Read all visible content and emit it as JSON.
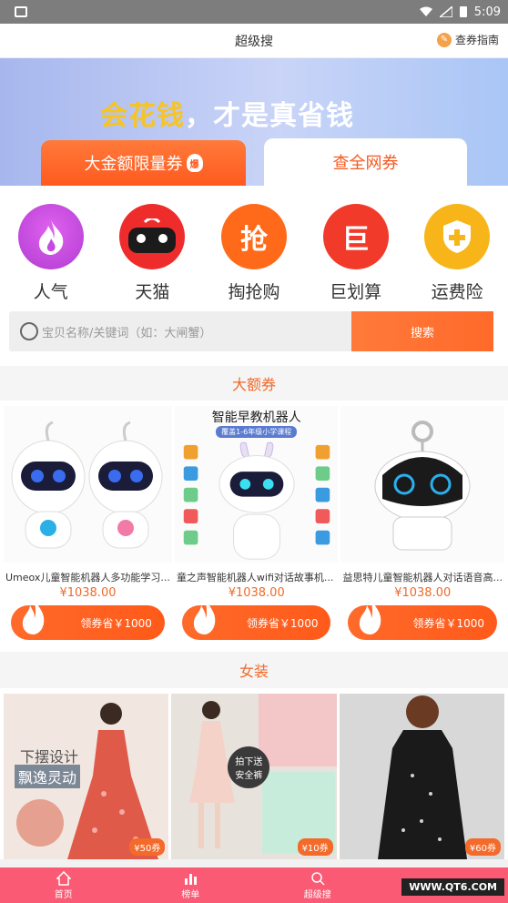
{
  "status_bar": {
    "time": "5:09"
  },
  "header": {
    "title": "超级搜",
    "guide_label": "查券指南"
  },
  "banner": {
    "slogan_part1": "会花钱",
    "slogan_part2": "，才是真省钱",
    "tab_big_coupon": "大金额限量券",
    "tab_big_coupon_badge": "爆",
    "tab_all_coupon": "查全网券"
  },
  "categories": [
    {
      "label": "人气",
      "icon": "fire-icon",
      "color": "#c64ae0"
    },
    {
      "label": "天猫",
      "icon": "tmall-bag-icon",
      "color": "#ee2c2c"
    },
    {
      "label": "掏抢购",
      "icon": "grab-icon",
      "glyph": "抢",
      "color": "#ff6a1a"
    },
    {
      "label": "巨划算",
      "icon": "ju-icon",
      "glyph": "巨",
      "color": "#f23a2a"
    },
    {
      "label": "运费险",
      "icon": "shield-plus-icon",
      "glyph": "+",
      "color": "#f7b51a"
    }
  ],
  "search": {
    "placeholder": "宝贝名称/关键词（如：大闸蟹）",
    "button_label": "搜索"
  },
  "sections": {
    "big_coupon_title": "大额券",
    "womens_title": "女装"
  },
  "big_coupon_products": [
    {
      "name": "Umeox儿童智能机器人多功能学习...",
      "price": "¥1038.00",
      "coupon": "领券省￥1000"
    },
    {
      "name": "童之声智能机器人wifi对话故事机...",
      "price": "¥1038.00",
      "coupon": "领券省￥1000",
      "image_title": "智能早教机器人",
      "image_subtitle": "覆盖1-6年级小学课程"
    },
    {
      "name": "益思特儿童智能机器人对话语音高...",
      "price": "¥1038.00",
      "coupon": "领券省￥1000"
    }
  ],
  "fashion_products": [
    {
      "tag": "¥50券",
      "overlay_1": "下摆设计",
      "overlay_2": "飘逸灵动",
      "colors": [
        "#f1e6e0",
        "#e05a4a"
      ]
    },
    {
      "tag": "¥10券",
      "overlay_1": "拍下送",
      "overlay_2": "安全裤",
      "colors": [
        "#e8e2dc",
        "#f3c6c8"
      ]
    },
    {
      "tag": "¥60券",
      "colors": [
        "#d8d8d8",
        "#1a1a1a"
      ]
    }
  ],
  "tab_bar": [
    {
      "label": "首页",
      "icon": "home-icon"
    },
    {
      "label": "榜单",
      "icon": "chart-icon"
    },
    {
      "label": "超级搜",
      "icon": "search-icon"
    },
    {
      "label": "",
      "icon": "crown-icon"
    }
  ],
  "watermark": "WWW.QT6.COM"
}
